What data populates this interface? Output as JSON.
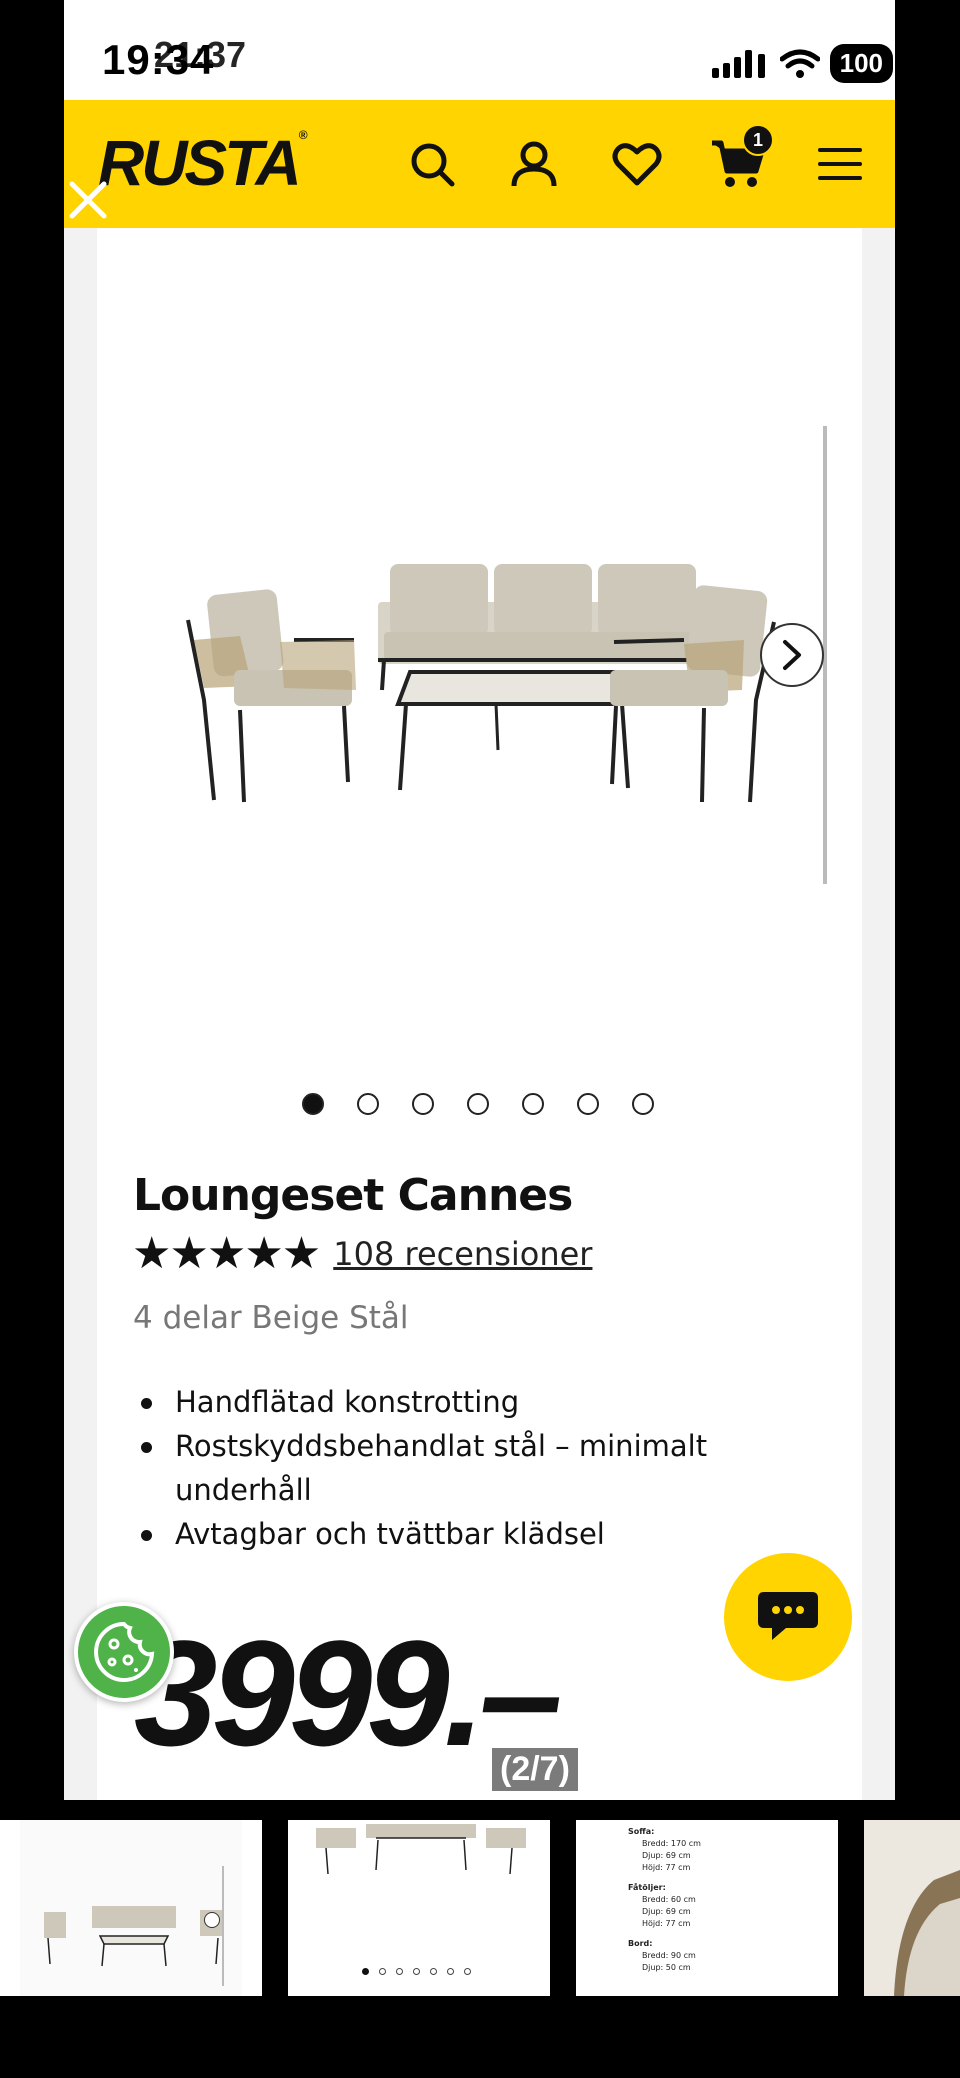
{
  "status_bar": {
    "time": "19:34",
    "time_overlay": "21:37",
    "battery": "100"
  },
  "header": {
    "logo": "RUSTA",
    "cart_count": "1"
  },
  "gallery": {
    "dot_count": 7,
    "active_index": 0
  },
  "product": {
    "title": "Loungeset Cannes",
    "stars": "★★★★★",
    "reviews": "108 recensioner",
    "subtitle": "4 delar Beige Stål",
    "features": [
      "Handflätad konstrotting",
      "Rostskyddsbehandlat stål – minimalt underhåll",
      "Avtagbar och tvättbar klädsel"
    ],
    "price": "3999.–"
  },
  "viewer": {
    "page_indicator": "(2/7)"
  },
  "thumb_dims": {
    "soffa_label": "Soffa:",
    "soffa": [
      "Bredd: 170 cm",
      "Djup: 69 cm",
      "Höjd: 77 cm"
    ],
    "fatolj_label": "Fåtöljer:",
    "fatolj": [
      "Bredd: 60 cm",
      "Djup: 69 cm",
      "Höjd: 77 cm"
    ],
    "bord_label": "Bord:",
    "bord": [
      "Bredd: 90 cm",
      "Djup: 50 cm"
    ]
  },
  "colors": {
    "brand_yellow": "#ffd400",
    "cookie_green": "#4fb34a",
    "text_dark": "#111111",
    "text_muted": "#777777"
  }
}
